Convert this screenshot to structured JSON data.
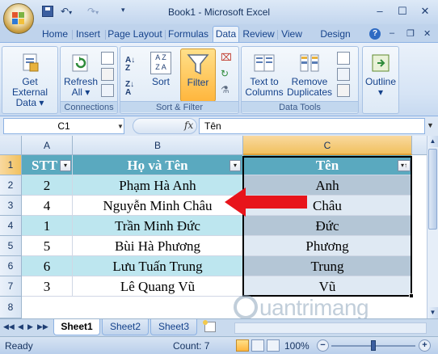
{
  "window": {
    "title": "Book1 - Microsoft Excel",
    "minimize": "–",
    "maximize": "☐",
    "close": "✕",
    "help": "?",
    "ribbon_min": "–",
    "ribbon_restore": "❐",
    "ribbon_close": "✕"
  },
  "qat": {
    "undo": "↶",
    "undo_drop": "▾",
    "redo": "↷",
    "redo_drop": "▾",
    "customize": "▾"
  },
  "tabs": [
    {
      "label": "Home"
    },
    {
      "label": "Insert"
    },
    {
      "label": "Page Layout"
    },
    {
      "label": "Formulas"
    },
    {
      "label": "Data"
    },
    {
      "label": "Review"
    },
    {
      "label": "View"
    },
    {
      "label": "Design"
    }
  ],
  "active_tab": "Data",
  "ribbon": {
    "get_external_data": {
      "label1": "Get External",
      "label2": "Data ▾"
    },
    "connections": {
      "refresh1": "Refresh",
      "refresh2": "All ▾",
      "group": "Connections"
    },
    "sort_filter": {
      "sort": "Sort",
      "filter": "Filter",
      "group": "Sort & Filter"
    },
    "data_tools": {
      "text1": "Text to",
      "text2": "Columns",
      "remove1": "Remove",
      "remove2": "Duplicates",
      "group": "Data Tools"
    },
    "outline": {
      "label1": "Outline",
      "label2": "▾"
    }
  },
  "formula_bar": {
    "name_box": "C1",
    "fx": "fx",
    "content": "Tên"
  },
  "columns": [
    "A",
    "B",
    "C"
  ],
  "rows": [
    "1",
    "2",
    "3",
    "4",
    "5",
    "6",
    "7",
    "8"
  ],
  "table": {
    "headers": [
      "STT",
      "Họ và Tên",
      "Tên"
    ],
    "rows": [
      [
        "2",
        "Phạm Hà Anh",
        "Anh"
      ],
      [
        "4",
        "Nguyễn Minh Châu",
        "Châu"
      ],
      [
        "1",
        "Trần Minh Đức",
        "Đức"
      ],
      [
        "5",
        "Bùi Hà Phương",
        "Phương"
      ],
      [
        "6",
        "Lưu Tuấn Trung",
        "Trung"
      ],
      [
        "3",
        "Lê Quang Vũ",
        "Vũ"
      ]
    ]
  },
  "filter_icons": {
    "a": "▾",
    "b": "▾",
    "c": "▾↑"
  },
  "sheets": [
    {
      "label": "Sheet1"
    },
    {
      "label": "Sheet2"
    },
    {
      "label": "Sheet3"
    }
  ],
  "active_sheet": "Sheet1",
  "sheet_nav": [
    "◀◀",
    "◀",
    "▶",
    "▶▶"
  ],
  "status": {
    "ready": "Ready",
    "count": "Count: 7",
    "zoom": "100%",
    "zoom_out": "−",
    "zoom_in": "+",
    "zoom_level": 1.0
  },
  "watermark": {
    "text": "uantrimang"
  },
  "colors": {
    "header_fill": "#5aa9bf",
    "band_fill": "#bde6ef",
    "arrow": "#e8141b",
    "active_col": "#f1c15f"
  }
}
